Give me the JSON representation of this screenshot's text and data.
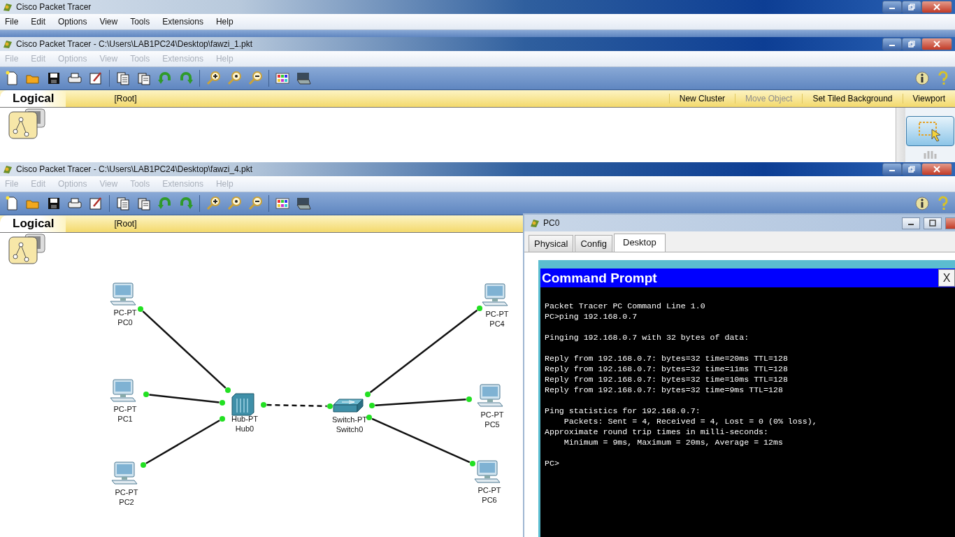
{
  "windows": [
    {
      "title": "Cisco Packet Tracer",
      "menu": [
        {
          "label": "File",
          "disabled": false
        },
        {
          "label": "Edit",
          "disabled": false
        },
        {
          "label": "Options",
          "disabled": false
        },
        {
          "label": "View",
          "disabled": false
        },
        {
          "label": "Tools",
          "disabled": false
        },
        {
          "label": "Extensions",
          "disabled": false
        },
        {
          "label": "Help",
          "disabled": false
        }
      ]
    },
    {
      "title": "Cisco Packet Tracer - C:\\Users\\LAB1PC24\\Desktop\\fawzi_1.pkt",
      "menu": [
        {
          "label": "File",
          "disabled": true
        },
        {
          "label": "Edit",
          "disabled": true
        },
        {
          "label": "Options",
          "disabled": true
        },
        {
          "label": "View",
          "disabled": true
        },
        {
          "label": "Tools",
          "disabled": true
        },
        {
          "label": "Extensions",
          "disabled": true
        },
        {
          "label": "Help",
          "disabled": true
        }
      ],
      "workspace": {
        "tab": "Logical",
        "path": "[Root]",
        "actions": [
          {
            "label": "New Cluster",
            "disabled": false
          },
          {
            "label": "Move Object",
            "disabled": true
          },
          {
            "label": "Set Tiled Background",
            "disabled": false
          },
          {
            "label": "Viewport",
            "disabled": false
          }
        ]
      }
    },
    {
      "title": "Cisco Packet Tracer - C:\\Users\\LAB1PC24\\Desktop\\fawzi_4.pkt",
      "menu": [
        {
          "label": "File",
          "disabled": true
        },
        {
          "label": "Edit",
          "disabled": true
        },
        {
          "label": "Options",
          "disabled": true
        },
        {
          "label": "View",
          "disabled": true
        },
        {
          "label": "Tools",
          "disabled": true
        },
        {
          "label": "Extensions",
          "disabled": true
        },
        {
          "label": "Help",
          "disabled": true
        }
      ],
      "workspace": {
        "tab": "Logical",
        "path": "[Root]",
        "devices": [
          {
            "kind": "pc",
            "model": "PC-PT",
            "name": "PC0"
          },
          {
            "kind": "pc",
            "model": "PC-PT",
            "name": "PC1"
          },
          {
            "kind": "pc",
            "model": "PC-PT",
            "name": "PC2"
          },
          {
            "kind": "hub",
            "model": "Hub-PT",
            "name": "Hub0"
          },
          {
            "kind": "switch",
            "model": "Switch-PT",
            "name": "Switch0"
          },
          {
            "kind": "pc",
            "model": "PC-PT",
            "name": "PC4"
          },
          {
            "kind": "pc",
            "model": "PC-PT",
            "name": "PC5"
          },
          {
            "kind": "pc",
            "model": "PC-PT",
            "name": "PC6"
          }
        ],
        "links": [
          {
            "kind": "straight",
            "up": true
          },
          {
            "kind": "straight",
            "up": true
          },
          {
            "kind": "straight",
            "up": true
          },
          {
            "kind": "crossover",
            "up": true
          },
          {
            "kind": "straight",
            "up": true
          },
          {
            "kind": "straight",
            "up": true
          },
          {
            "kind": "straight",
            "up": true
          }
        ]
      }
    }
  ],
  "pc_window": {
    "title": "PC0",
    "tabs": [
      {
        "label": "Physical",
        "selected": false
      },
      {
        "label": "Config",
        "selected": false
      },
      {
        "label": "Desktop",
        "selected": true
      }
    ],
    "command_prompt": {
      "title": "Command Prompt",
      "close": "X",
      "blocks": [
        [
          "Packet Tracer PC Command Line 1.0",
          "PC>ping 192.168.0.7"
        ],
        [
          "Pinging 192.168.0.7 with 32 bytes of data:"
        ],
        [
          "Reply from 192.168.0.7: bytes=32 time=20ms TTL=128",
          "Reply from 192.168.0.7: bytes=32 time=11ms TTL=128",
          "Reply from 192.168.0.7: bytes=32 time=10ms TTL=128",
          "Reply from 192.168.0.7: bytes=32 time=9ms TTL=128"
        ],
        [
          "Ping statistics for 192.168.0.7:",
          "    Packets: Sent = 4, Received = 4, Lost = 0 (0% loss),",
          "Approximate round trip times in milli-seconds:",
          "    Minimum = 9ms, Maximum = 20ms, Average = 12ms"
        ],
        [
          "PC>"
        ]
      ]
    }
  }
}
